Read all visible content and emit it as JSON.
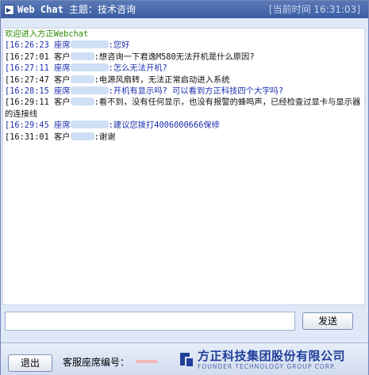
{
  "titlebar": {
    "app_name": "Web Chat",
    "topic": "主题：技术咨询",
    "current_time": "[当前时间 16:31:03]"
  },
  "chat": {
    "welcome": "欢迎进入方正Webchat",
    "messages": [
      {
        "role": "agent",
        "time": "[16:26:23",
        "sender": "座席",
        "text": ":您好"
      },
      {
        "role": "customer",
        "time": "[16:27:01",
        "sender": "客户",
        "text": ":想咨询一下君逸M580无法开机是什么原因?"
      },
      {
        "role": "agent",
        "time": "[16:27:11",
        "sender": "座席",
        "text": ":怎么无法开机?"
      },
      {
        "role": "customer",
        "time": "[16:27:47",
        "sender": "客户",
        "text": ":电源风扇转，无法正常启动进入系统"
      },
      {
        "role": "agent",
        "time": "[16:28:15",
        "sender": "座席",
        "text": ":开机有显示吗? 可以看到方正科技四个大字吗?"
      },
      {
        "role": "customer",
        "time": "[16:29:11",
        "sender": "客户",
        "text": ":看不到，没有任何显示，也没有报警的蜂鸣声，已经检查过显卡与显示器的连接线"
      },
      {
        "role": "agent",
        "time": "[16:29:45",
        "sender": "座席",
        "text": ":建议您拨打4006000666保修"
      },
      {
        "role": "customer",
        "time": "[16:31:01",
        "sender": "客户",
        "text": ":谢谢"
      }
    ]
  },
  "input": {
    "value": ""
  },
  "buttons": {
    "send": "发送",
    "exit": "退出"
  },
  "footer": {
    "seat_label": "客服座席编号：",
    "company_cn": "方正科技集团股份有限公司",
    "company_en": "FOUNDER TECHNOLOGY GROUP CORP."
  },
  "icons": {
    "title": "chat-window-icon",
    "logo": "founder-logo-icon"
  },
  "colors": {
    "agent_text": "#1b2fae",
    "customer_text": "#111111",
    "welcome_text": "#2a8a00",
    "brand": "#1f3f9b"
  }
}
